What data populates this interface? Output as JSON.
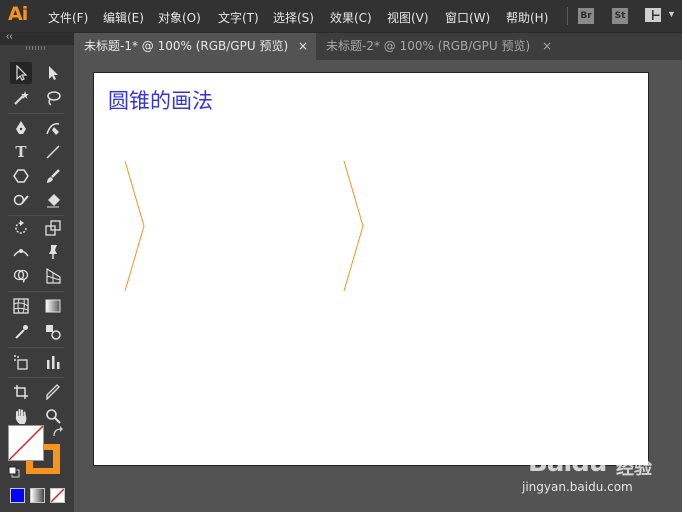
{
  "app": {
    "logo": "Ai",
    "brand_color": "#f7931e"
  },
  "menu": {
    "items": [
      {
        "id": "file",
        "label": "文件(F)"
      },
      {
        "id": "edit",
        "label": "编辑(E)"
      },
      {
        "id": "object",
        "label": "对象(O)"
      },
      {
        "id": "type",
        "label": "文字(T)"
      },
      {
        "id": "select",
        "label": "选择(S)"
      },
      {
        "id": "effect",
        "label": "效果(C)"
      },
      {
        "id": "view",
        "label": "视图(V)"
      },
      {
        "id": "window",
        "label": "窗口(W)"
      },
      {
        "id": "help",
        "label": "帮助(H)"
      }
    ],
    "bridge_badge": "Br",
    "stock_badge": "St"
  },
  "tabs": [
    {
      "label": "未标题-1* @ 100% (RGB/GPU 预览)",
      "close": "×",
      "active": true
    },
    {
      "label": "未标题-2* @ 100% (RGB/GPU 预览)",
      "close": "×",
      "active": false
    }
  ],
  "toolbar": {
    "collapse_glyph": "‹‹",
    "type_tool_glyph": "T",
    "colors": {
      "fill": "#ffffff",
      "stroke": "#f7931e",
      "color_mode": "#0000ff"
    }
  },
  "artboard": {
    "title": "圆锥的画法",
    "title_color": "#3333e0",
    "shape_stroke": "#f7931e"
  },
  "watermark": {
    "brand": "Baidu",
    "cn": "经验",
    "url": "jingyan.baidu.com"
  }
}
